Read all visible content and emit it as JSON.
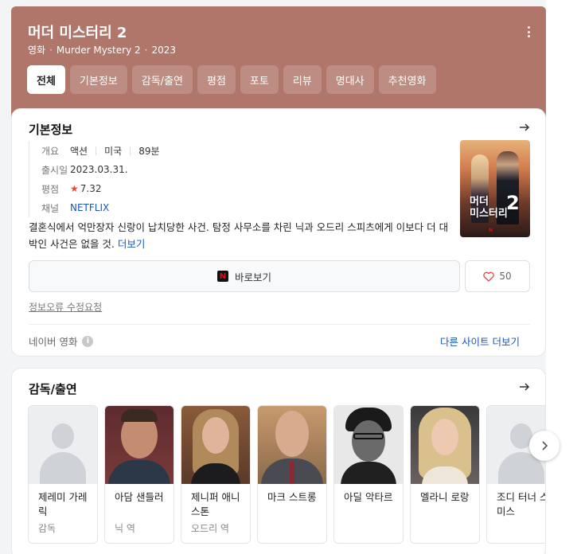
{
  "header": {
    "title": "머더 미스터리 2",
    "category": "영화",
    "original_title": "Murder Mystery 2",
    "year": "2023",
    "tabs": [
      {
        "label": "전체"
      },
      {
        "label": "기본정보"
      },
      {
        "label": "감독/출연"
      },
      {
        "label": "평점"
      },
      {
        "label": "포토"
      },
      {
        "label": "리뷰"
      },
      {
        "label": "명대사"
      },
      {
        "label": "추천영화"
      }
    ]
  },
  "basic": {
    "title": "기본정보",
    "overview_label": "개요",
    "genre": "액션",
    "country": "미국",
    "runtime": "89분",
    "release_label": "출시일",
    "release_date": "2023.03.31.",
    "rating_label": "평점",
    "rating": "7.32",
    "channel_label": "채널",
    "channel": "NETFLIX",
    "synopsis": "결혼식에서 억만장자 신랑이 납치당한 사건. 탐정 사무소를 차린 닉과 오드리 스피츠에게 이보다 더 대박인 사건은 없을 것.",
    "more": "더보기",
    "poster_title_line1": "머더",
    "poster_title_line2": "미스터리",
    "poster_number": "2",
    "watch_label": "바로보기",
    "like_count": "50",
    "report_label": "정보오류 수정요청",
    "source_label": "네이버 영화",
    "more_sites_label": "다른 사이트 더보기"
  },
  "cast": {
    "title": "감독/출연",
    "members": [
      {
        "name": "제레미 가레릭",
        "role": "감독"
      },
      {
        "name": "아담 샌들러",
        "role": "닉 역"
      },
      {
        "name": "제니퍼 애니스톤",
        "role": "오드리 역"
      },
      {
        "name": "마크 스트롱",
        "role": ""
      },
      {
        "name": "아딜 악타르",
        "role": ""
      },
      {
        "name": "멜라니 로랑",
        "role": ""
      },
      {
        "name": "조디 터너 스미스",
        "role": ""
      }
    ]
  },
  "colors": {
    "header_bg": "#b0766a",
    "link": "#1a55c0",
    "star": "#e8453c"
  },
  "icons": [
    "more-vertical-icon",
    "arrow-right-icon",
    "star-icon",
    "netflix-icon",
    "heart-icon",
    "info-icon",
    "chevron-right-icon"
  ]
}
